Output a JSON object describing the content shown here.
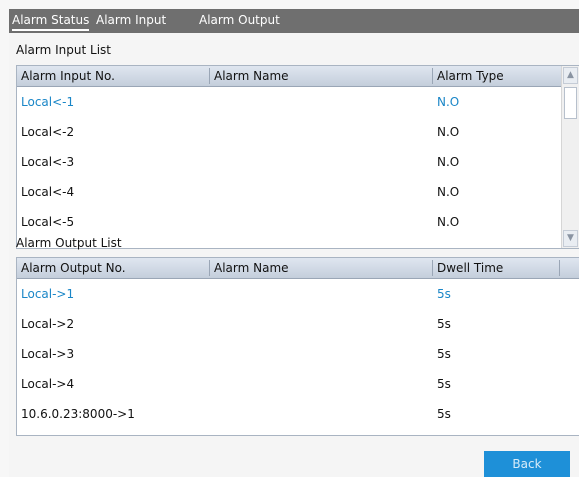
{
  "tabs": [
    {
      "label": "Alarm Status"
    },
    {
      "label": "Alarm Input"
    },
    {
      "label": "Alarm Output"
    }
  ],
  "input_list": {
    "title": "Alarm Input List",
    "headers": [
      "Alarm Input No.",
      "Alarm Name",
      "Alarm Type"
    ],
    "rows": [
      {
        "no": "Local<-1",
        "name": "",
        "type": "N.O"
      },
      {
        "no": "Local<-2",
        "name": "",
        "type": "N.O"
      },
      {
        "no": "Local<-3",
        "name": "",
        "type": "N.O"
      },
      {
        "no": "Local<-4",
        "name": "",
        "type": "N.O"
      },
      {
        "no": "Local<-5",
        "name": "",
        "type": "N.O"
      }
    ],
    "selected_row": 0
  },
  "output_list": {
    "title": "Alarm Output List",
    "headers": [
      "Alarm Output No.",
      "Alarm Name",
      "Dwell Time"
    ],
    "rows": [
      {
        "no": "Local->1",
        "name": "",
        "dwell": "5s"
      },
      {
        "no": "Local->2",
        "name": "",
        "dwell": "5s"
      },
      {
        "no": "Local->3",
        "name": "",
        "dwell": "5s"
      },
      {
        "no": "Local->4",
        "name": "",
        "dwell": "5s"
      },
      {
        "no": "10.6.0.23:8000->1",
        "name": "",
        "dwell": "5s"
      }
    ],
    "selected_row": 0
  },
  "back_label": "Back",
  "icons": {
    "scroll_up": "chevron-up-icon",
    "scroll_down": "chevron-down-icon"
  },
  "colors": {
    "accent": "#1e90d8",
    "selected_text": "#1a86c7",
    "tab_bar": "#6f6f6f"
  }
}
